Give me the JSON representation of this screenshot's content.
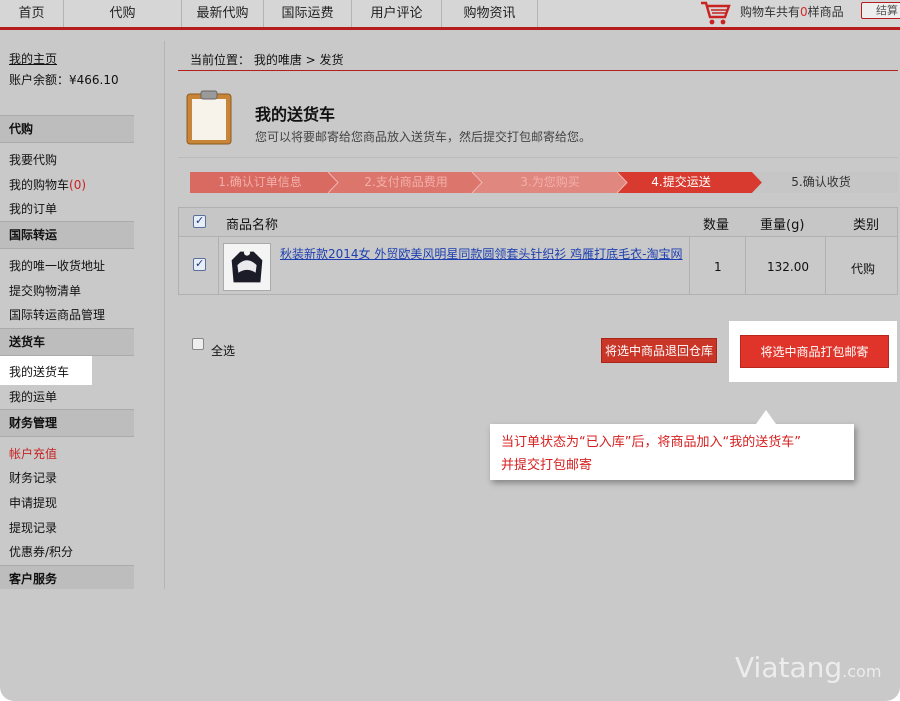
{
  "nav": {
    "items": [
      "首页",
      "代购",
      "最新代购",
      "国际运费",
      "用户评论",
      "购物资讯"
    ],
    "cart_prefix": "购物车共有",
    "cart_count": "0",
    "cart_suffix": "样商品",
    "checkout_label": "结算"
  },
  "sidebar": {
    "home_link": "我的主页",
    "balance": "账户余额：¥466.10",
    "sections": [
      {
        "header": "代购",
        "items": [
          {
            "label": "我要代购"
          },
          {
            "label": "我的购物车",
            "badge": "(0)"
          },
          {
            "label": "我的订单"
          }
        ]
      },
      {
        "header": "国际转运",
        "items": [
          {
            "label": "我的唯一收货地址"
          },
          {
            "label": "提交购物清单"
          },
          {
            "label": "国际转运商品管理"
          }
        ]
      },
      {
        "header": "送货车",
        "items": [
          {
            "label": "我的送货车"
          },
          {
            "label": "我的运单"
          }
        ]
      },
      {
        "header": "财务管理",
        "items": [
          {
            "label": "帐户充值"
          },
          {
            "label": "财务记录"
          },
          {
            "label": "申请提现"
          },
          {
            "label": "提现记录"
          },
          {
            "label": "优惠券/积分"
          }
        ]
      },
      {
        "header": "客户服务",
        "items": []
      }
    ]
  },
  "main": {
    "breadcrumb": "当前位置： 我的唯唐 > 发货",
    "title": "我的送货车",
    "subtitle": "您可以将要邮寄给您商品放入送货车，然后提交打包邮寄给您。",
    "steps": [
      "1.确认订单信息",
      "2.支付商品费用",
      "3.为您购买",
      "4.提交运送",
      "5.确认收货"
    ],
    "active_step": 4,
    "table": {
      "headers": [
        "商品名称",
        "数量",
        "重量(g)",
        "类别"
      ],
      "rows": [
        {
          "name": "秋装新款2014女 外贸欧美风明星同款圆领套头针织衫 鸡雁打底毛衣-淘宝网",
          "qty": "1",
          "weight": "132.00",
          "category": "代购",
          "checked": true
        }
      ]
    },
    "select_all": "全选",
    "return_button": "将选中商品退回仓库",
    "ship_button": "将选中商品打包邮寄"
  },
  "callout": {
    "line1": "当订单状态为“已入库”后，将商品加入“我的送货车”",
    "line2": "并提交打包邮寄"
  },
  "watermark": {
    "brand": "Viatang",
    "suffix": ".com"
  },
  "colors": {
    "accent": "#b71d1d",
    "button_red": "#e0342a",
    "callout_text": "#d62020",
    "link": "#1d3fb0"
  }
}
